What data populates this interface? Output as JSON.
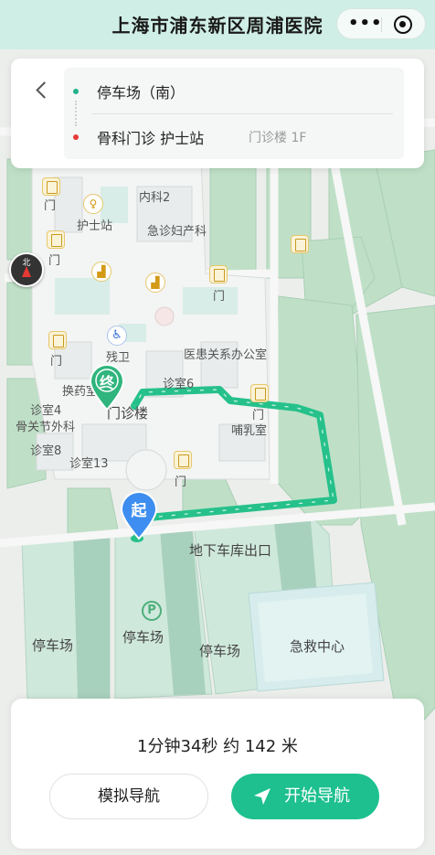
{
  "header": {
    "title": "上海市浦东新区周浦医院",
    "more_icon": "more-dots-icon",
    "close_icon": "target-icon"
  },
  "route": {
    "from": "停车场（南）",
    "to": "骨科门诊 护士站",
    "to_sub": "门诊楼 1F",
    "from_color": "#21b38a",
    "to_color": "#e53935"
  },
  "map": {
    "compass": "北",
    "labels": {
      "emergency_ob": "急诊妇产科",
      "neike": "内科2",
      "nurse_station": "护士站",
      "canwei": "残卫",
      "yihuan_office": "医患关系办公室",
      "huanyao": "换药室",
      "zhenshi6": "诊室6",
      "zhenshi4": "诊室4",
      "guguanjie": "骨关节外科",
      "zhenshi8": "诊室8",
      "zhenshi13": "诊室13",
      "menzhen_building": "门诊楼",
      "buru": "哺乳室",
      "garage_exit": "地下车库出口",
      "parking1": "停车场",
      "parking2": "停车场",
      "parking3": "停车场",
      "emergency_center": "急救中心",
      "door": "门"
    },
    "pin_start": "起",
    "pin_end": "终",
    "accent": "#1dc08e"
  },
  "sheet": {
    "summary": "1分钟34秒 约 142 米",
    "simulate_label": "模拟导航",
    "start_label": "开始导航",
    "start_color": "#1dc08e"
  }
}
